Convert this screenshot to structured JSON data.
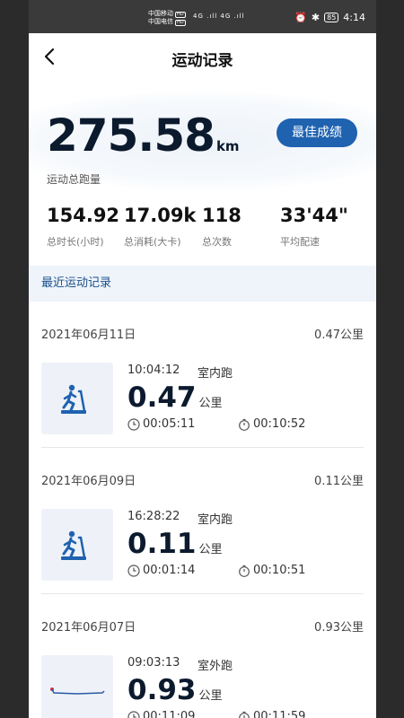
{
  "status_bar": {
    "carrier1": "中国移动",
    "carrier2": "中国电信",
    "hd": "HD",
    "signal": "4G .ıll 4G .ıll",
    "battery": "85",
    "time": "4:14"
  },
  "header": {
    "title": "运动记录"
  },
  "summary": {
    "total_km": "275.58",
    "unit": "km",
    "total_label": "运动总跑量",
    "best_button": "最佳成绩",
    "stats": [
      {
        "value": "154.92",
        "label": "总时长(小时)"
      },
      {
        "value": "17.09k",
        "label": "总消耗(大卡)"
      },
      {
        "value": "118",
        "label": "总次数"
      },
      {
        "value": "33'44\"",
        "label": "平均配速"
      }
    ]
  },
  "section": {
    "title": "最近运动记录"
  },
  "records": [
    {
      "date": "2021年06月11日",
      "day_distance": "0.47公里",
      "time": "10:04:12",
      "type": "室内跑",
      "distance": "0.47",
      "unit": "公里",
      "duration": "00:05:11",
      "pace": "00:10:52",
      "icon": "treadmill-icon"
    },
    {
      "date": "2021年06月09日",
      "day_distance": "0.11公里",
      "time": "16:28:22",
      "type": "室内跑",
      "distance": "0.11",
      "unit": "公里",
      "duration": "00:01:14",
      "pace": "00:10:51",
      "icon": "treadmill-icon"
    },
    {
      "date": "2021年06月07日",
      "day_distance": "0.93公里",
      "time": "09:03:13",
      "type": "室外跑",
      "distance": "0.93",
      "unit": "公里",
      "duration": "00:11:09",
      "pace": "00:11:59",
      "icon": "route-map-icon"
    }
  ],
  "colors": {
    "accent": "#1f62b0",
    "section_bg": "#eef4f9",
    "text_dark": "#0c1a2e"
  }
}
